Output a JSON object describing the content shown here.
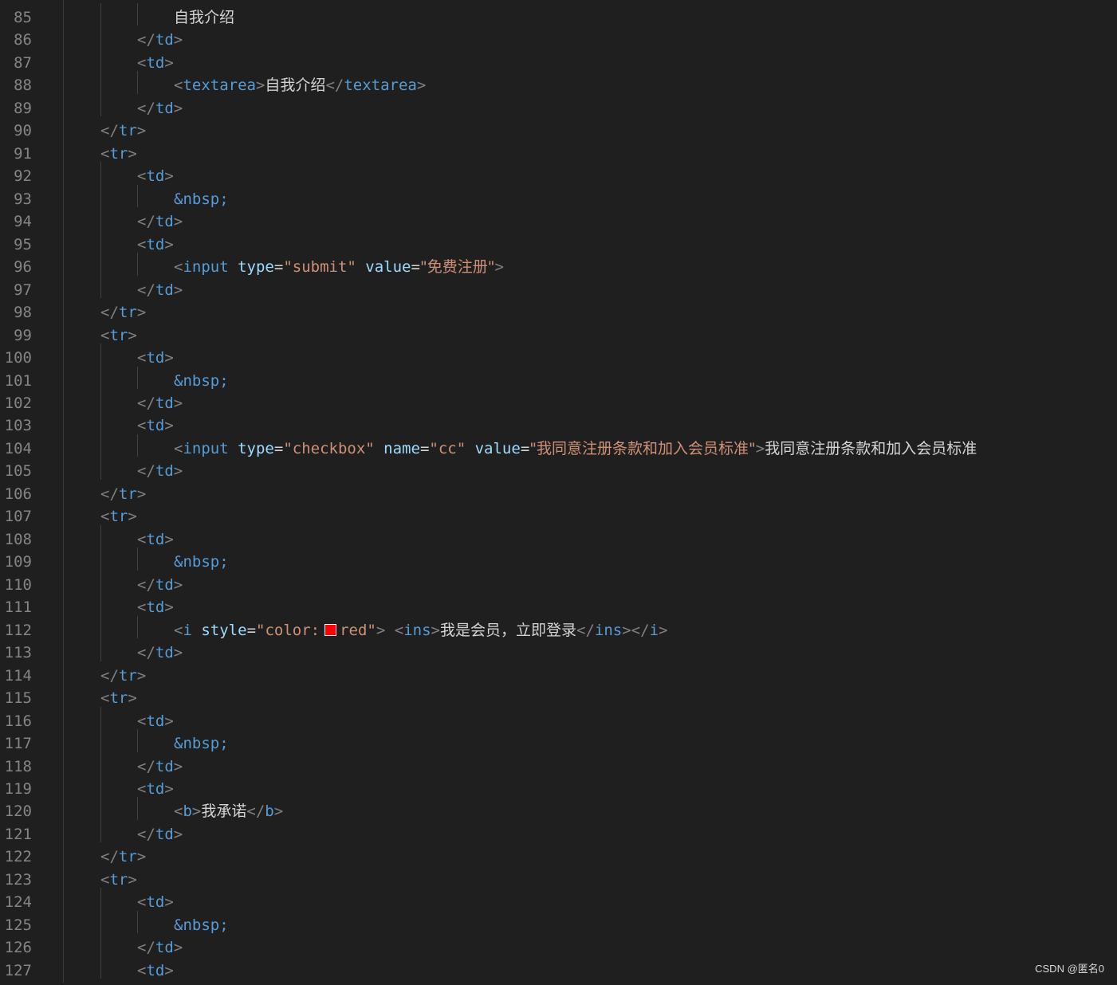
{
  "editor": {
    "lines": [
      {
        "number": "85",
        "indent": 3,
        "tokens": [
          {
            "t": "txt",
            "v": "自我介绍"
          }
        ]
      },
      {
        "number": "86",
        "indent": 2,
        "tokens": [
          {
            "t": "br",
            "v": "</"
          },
          {
            "t": "tag",
            "v": "td"
          },
          {
            "t": "br",
            "v": ">"
          }
        ]
      },
      {
        "number": "87",
        "indent": 2,
        "tokens": [
          {
            "t": "br",
            "v": "<"
          },
          {
            "t": "tag",
            "v": "td"
          },
          {
            "t": "br",
            "v": ">"
          }
        ]
      },
      {
        "number": "88",
        "indent": 3,
        "tokens": [
          {
            "t": "br",
            "v": "<"
          },
          {
            "t": "tag",
            "v": "textarea"
          },
          {
            "t": "br",
            "v": ">"
          },
          {
            "t": "txt",
            "v": "自我介绍"
          },
          {
            "t": "br",
            "v": "</"
          },
          {
            "t": "tag",
            "v": "textarea"
          },
          {
            "t": "br",
            "v": ">"
          }
        ]
      },
      {
        "number": "89",
        "indent": 2,
        "tokens": [
          {
            "t": "br",
            "v": "</"
          },
          {
            "t": "tag",
            "v": "td"
          },
          {
            "t": "br",
            "v": ">"
          }
        ]
      },
      {
        "number": "90",
        "indent": 1,
        "tokens": [
          {
            "t": "br",
            "v": "</"
          },
          {
            "t": "tag",
            "v": "tr"
          },
          {
            "t": "br",
            "v": ">"
          }
        ]
      },
      {
        "number": "91",
        "indent": 1,
        "tokens": [
          {
            "t": "br",
            "v": "<"
          },
          {
            "t": "tag",
            "v": "tr"
          },
          {
            "t": "br",
            "v": ">"
          }
        ]
      },
      {
        "number": "92",
        "indent": 2,
        "tokens": [
          {
            "t": "br",
            "v": "<"
          },
          {
            "t": "tag",
            "v": "td"
          },
          {
            "t": "br",
            "v": ">"
          }
        ]
      },
      {
        "number": "93",
        "indent": 3,
        "tokens": [
          {
            "t": "ent",
            "v": "&nbsp;"
          }
        ]
      },
      {
        "number": "94",
        "indent": 2,
        "tokens": [
          {
            "t": "br",
            "v": "</"
          },
          {
            "t": "tag",
            "v": "td"
          },
          {
            "t": "br",
            "v": ">"
          }
        ]
      },
      {
        "number": "95",
        "indent": 2,
        "tokens": [
          {
            "t": "br",
            "v": "<"
          },
          {
            "t": "tag",
            "v": "td"
          },
          {
            "t": "br",
            "v": ">"
          }
        ]
      },
      {
        "number": "96",
        "indent": 3,
        "tokens": [
          {
            "t": "br",
            "v": "<"
          },
          {
            "t": "tag",
            "v": "input"
          },
          {
            "t": "txt",
            "v": " "
          },
          {
            "t": "attr",
            "v": "type"
          },
          {
            "t": "txt",
            "v": "="
          },
          {
            "t": "str",
            "v": "\"submit\""
          },
          {
            "t": "txt",
            "v": " "
          },
          {
            "t": "attr",
            "v": "value"
          },
          {
            "t": "txt",
            "v": "="
          },
          {
            "t": "str",
            "v": "\"免费注册\""
          },
          {
            "t": "br",
            "v": ">"
          }
        ]
      },
      {
        "number": "97",
        "indent": 2,
        "tokens": [
          {
            "t": "br",
            "v": "</"
          },
          {
            "t": "tag",
            "v": "td"
          },
          {
            "t": "br",
            "v": ">"
          }
        ]
      },
      {
        "number": "98",
        "indent": 1,
        "tokens": [
          {
            "t": "br",
            "v": "</"
          },
          {
            "t": "tag",
            "v": "tr"
          },
          {
            "t": "br",
            "v": ">"
          }
        ]
      },
      {
        "number": "99",
        "indent": 1,
        "tokens": [
          {
            "t": "br",
            "v": "<"
          },
          {
            "t": "tag",
            "v": "tr"
          },
          {
            "t": "br",
            "v": ">"
          }
        ]
      },
      {
        "number": "100",
        "indent": 2,
        "tokens": [
          {
            "t": "br",
            "v": "<"
          },
          {
            "t": "tag",
            "v": "td"
          },
          {
            "t": "br",
            "v": ">"
          }
        ]
      },
      {
        "number": "101",
        "indent": 3,
        "tokens": [
          {
            "t": "ent",
            "v": "&nbsp;"
          }
        ]
      },
      {
        "number": "102",
        "indent": 2,
        "tokens": [
          {
            "t": "br",
            "v": "</"
          },
          {
            "t": "tag",
            "v": "td"
          },
          {
            "t": "br",
            "v": ">"
          }
        ]
      },
      {
        "number": "103",
        "indent": 2,
        "tokens": [
          {
            "t": "br",
            "v": "<"
          },
          {
            "t": "tag",
            "v": "td"
          },
          {
            "t": "br",
            "v": ">"
          }
        ]
      },
      {
        "number": "104",
        "indent": 3,
        "tokens": [
          {
            "t": "br",
            "v": "<"
          },
          {
            "t": "tag",
            "v": "input"
          },
          {
            "t": "txt",
            "v": " "
          },
          {
            "t": "attr",
            "v": "type"
          },
          {
            "t": "txt",
            "v": "="
          },
          {
            "t": "str",
            "v": "\"checkbox\""
          },
          {
            "t": "txt",
            "v": " "
          },
          {
            "t": "attr",
            "v": "name"
          },
          {
            "t": "txt",
            "v": "="
          },
          {
            "t": "str",
            "v": "\"cc\""
          },
          {
            "t": "txt",
            "v": " "
          },
          {
            "t": "attr",
            "v": "value"
          },
          {
            "t": "txt",
            "v": "="
          },
          {
            "t": "str",
            "v": "\"我同意注册条款和加入会员标准\""
          },
          {
            "t": "br",
            "v": ">"
          },
          {
            "t": "txt",
            "v": "我同意注册条款和加入会员标准"
          }
        ]
      },
      {
        "number": "105",
        "indent": 2,
        "tokens": [
          {
            "t": "br",
            "v": "</"
          },
          {
            "t": "tag",
            "v": "td"
          },
          {
            "t": "br",
            "v": ">"
          }
        ]
      },
      {
        "number": "106",
        "indent": 1,
        "tokens": [
          {
            "t": "br",
            "v": "</"
          },
          {
            "t": "tag",
            "v": "tr"
          },
          {
            "t": "br",
            "v": ">"
          }
        ]
      },
      {
        "number": "107",
        "indent": 1,
        "tokens": [
          {
            "t": "br",
            "v": "<"
          },
          {
            "t": "tag",
            "v": "tr"
          },
          {
            "t": "br",
            "v": ">"
          }
        ]
      },
      {
        "number": "108",
        "indent": 2,
        "tokens": [
          {
            "t": "br",
            "v": "<"
          },
          {
            "t": "tag",
            "v": "td"
          },
          {
            "t": "br",
            "v": ">"
          }
        ]
      },
      {
        "number": "109",
        "indent": 3,
        "tokens": [
          {
            "t": "ent",
            "v": "&nbsp;"
          }
        ]
      },
      {
        "number": "110",
        "indent": 2,
        "tokens": [
          {
            "t": "br",
            "v": "</"
          },
          {
            "t": "tag",
            "v": "td"
          },
          {
            "t": "br",
            "v": ">"
          }
        ]
      },
      {
        "number": "111",
        "indent": 2,
        "tokens": [
          {
            "t": "br",
            "v": "<"
          },
          {
            "t": "tag",
            "v": "td"
          },
          {
            "t": "br",
            "v": ">"
          }
        ]
      },
      {
        "number": "112",
        "indent": 3,
        "tokens": [
          {
            "t": "br",
            "v": "<"
          },
          {
            "t": "tag",
            "v": "i"
          },
          {
            "t": "txt",
            "v": " "
          },
          {
            "t": "attr",
            "v": "style"
          },
          {
            "t": "txt",
            "v": "="
          },
          {
            "t": "str",
            "v": "\"color:"
          },
          {
            "t": "swatch",
            "v": "#ff0000"
          },
          {
            "t": "str",
            "v": "red\""
          },
          {
            "t": "br",
            "v": ">"
          },
          {
            "t": "txt",
            "v": " "
          },
          {
            "t": "br",
            "v": "<"
          },
          {
            "t": "tag",
            "v": "ins"
          },
          {
            "t": "br",
            "v": ">"
          },
          {
            "t": "txt",
            "v": "我是会员，立即登录"
          },
          {
            "t": "br",
            "v": "</"
          },
          {
            "t": "tag",
            "v": "ins"
          },
          {
            "t": "br",
            "v": "></"
          },
          {
            "t": "tag",
            "v": "i"
          },
          {
            "t": "br",
            "v": ">"
          }
        ]
      },
      {
        "number": "113",
        "indent": 2,
        "tokens": [
          {
            "t": "br",
            "v": "</"
          },
          {
            "t": "tag",
            "v": "td"
          },
          {
            "t": "br",
            "v": ">"
          }
        ]
      },
      {
        "number": "114",
        "indent": 1,
        "tokens": [
          {
            "t": "br",
            "v": "</"
          },
          {
            "t": "tag",
            "v": "tr"
          },
          {
            "t": "br",
            "v": ">"
          }
        ]
      },
      {
        "number": "115",
        "indent": 1,
        "tokens": [
          {
            "t": "br",
            "v": "<"
          },
          {
            "t": "tag",
            "v": "tr"
          },
          {
            "t": "br",
            "v": ">"
          }
        ]
      },
      {
        "number": "116",
        "indent": 2,
        "tokens": [
          {
            "t": "br",
            "v": "<"
          },
          {
            "t": "tag",
            "v": "td"
          },
          {
            "t": "br",
            "v": ">"
          }
        ]
      },
      {
        "number": "117",
        "indent": 3,
        "tokens": [
          {
            "t": "ent",
            "v": "&nbsp;"
          }
        ]
      },
      {
        "number": "118",
        "indent": 2,
        "tokens": [
          {
            "t": "br",
            "v": "</"
          },
          {
            "t": "tag",
            "v": "td"
          },
          {
            "t": "br",
            "v": ">"
          }
        ]
      },
      {
        "number": "119",
        "indent": 2,
        "tokens": [
          {
            "t": "br",
            "v": "<"
          },
          {
            "t": "tag",
            "v": "td"
          },
          {
            "t": "br",
            "v": ">"
          }
        ]
      },
      {
        "number": "120",
        "indent": 3,
        "tokens": [
          {
            "t": "br",
            "v": "<"
          },
          {
            "t": "tag",
            "v": "b"
          },
          {
            "t": "br",
            "v": ">"
          },
          {
            "t": "txt",
            "v": "我承诺"
          },
          {
            "t": "br",
            "v": "</"
          },
          {
            "t": "tag",
            "v": "b"
          },
          {
            "t": "br",
            "v": ">"
          }
        ]
      },
      {
        "number": "121",
        "indent": 2,
        "tokens": [
          {
            "t": "br",
            "v": "</"
          },
          {
            "t": "tag",
            "v": "td"
          },
          {
            "t": "br",
            "v": ">"
          }
        ]
      },
      {
        "number": "122",
        "indent": 1,
        "tokens": [
          {
            "t": "br",
            "v": "</"
          },
          {
            "t": "tag",
            "v": "tr"
          },
          {
            "t": "br",
            "v": ">"
          }
        ]
      },
      {
        "number": "123",
        "indent": 1,
        "tokens": [
          {
            "t": "br",
            "v": "<"
          },
          {
            "t": "tag",
            "v": "tr"
          },
          {
            "t": "br",
            "v": ">"
          }
        ]
      },
      {
        "number": "124",
        "indent": 2,
        "tokens": [
          {
            "t": "br",
            "v": "<"
          },
          {
            "t": "tag",
            "v": "td"
          },
          {
            "t": "br",
            "v": ">"
          }
        ]
      },
      {
        "number": "125",
        "indent": 3,
        "tokens": [
          {
            "t": "ent",
            "v": "&nbsp;"
          }
        ]
      },
      {
        "number": "126",
        "indent": 2,
        "tokens": [
          {
            "t": "br",
            "v": "</"
          },
          {
            "t": "tag",
            "v": "td"
          },
          {
            "t": "br",
            "v": ">"
          }
        ]
      },
      {
        "number": "127",
        "indent": 2,
        "tokens": [
          {
            "t": "br",
            "v": "<"
          },
          {
            "t": "tag",
            "v": "td"
          },
          {
            "t": "br",
            "v": ">"
          }
        ]
      }
    ]
  },
  "watermark": "CSDN @匿名0",
  "colors": {
    "background": "#1f1f1f",
    "line_number": "#858585",
    "bracket": "#808080",
    "tag": "#569cd6",
    "attribute": "#9cdcfe",
    "string": "#ce9178",
    "text": "#d4d4d4",
    "swatch_red": "#ff0000"
  }
}
